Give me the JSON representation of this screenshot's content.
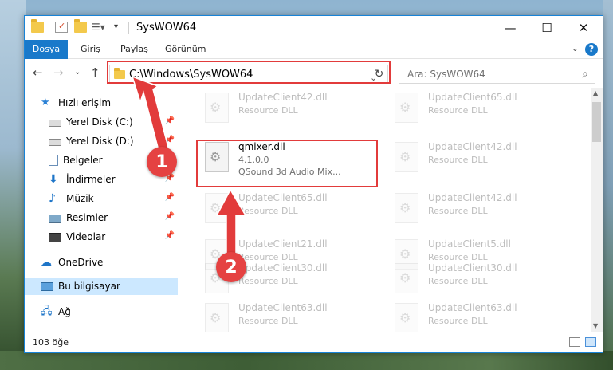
{
  "window": {
    "title": "SysWOW64",
    "minimize": "—",
    "maximize": "☐",
    "close": "✕"
  },
  "ribbon": {
    "tabs": [
      "Dosya",
      "Giriş",
      "Paylaş",
      "Görünüm"
    ],
    "help": "?"
  },
  "nav": {
    "address": "C:\\Windows\\SysWOW64",
    "search_placeholder": "Ara: SysWOW64"
  },
  "sidebar": {
    "items": [
      {
        "label": "Hızlı erişim",
        "icon": "star-icon"
      },
      {
        "label": "Yerel Disk (C:)",
        "icon": "drive-icon"
      },
      {
        "label": "Yerel Disk (D:)",
        "icon": "drive-icon"
      },
      {
        "label": "Belgeler",
        "icon": "documents-icon"
      },
      {
        "label": "İndirmeler",
        "icon": "download-icon"
      },
      {
        "label": "Müzik",
        "icon": "music-icon"
      },
      {
        "label": "Resimler",
        "icon": "pictures-icon"
      },
      {
        "label": "Videolar",
        "icon": "video-icon"
      },
      {
        "label": "OneDrive",
        "icon": "cloud-icon"
      },
      {
        "label": "Bu bilgisayar",
        "icon": "computer-icon"
      },
      {
        "label": "Ağ",
        "icon": "network-icon"
      }
    ]
  },
  "files": [
    {
      "name": "UpdateClient42.dll",
      "type": "Resource DLL"
    },
    {
      "name": "UpdateClient65.dll",
      "type": "Resource DLL"
    },
    {
      "name": "qmixer.dll",
      "type": "4.1.0.0",
      "desc": "QSound 3d Audio Mix..."
    },
    {
      "name": "UpdateClient42.dll",
      "type": "Resource DLL"
    },
    {
      "name": "UpdateClient65.dll",
      "type": "Resource DLL"
    },
    {
      "name": "UpdateClient42.dll",
      "type": "Resource DLL"
    },
    {
      "name": "UpdateClient21.dll",
      "type": "Resource DLL"
    },
    {
      "name": "UpdateClient5.dll",
      "type": "Resource DLL"
    },
    {
      "name": "UpdateClient30.dll",
      "type": "Resource DLL"
    },
    {
      "name": "UpdateClient30.dll",
      "type": "Resource DLL"
    },
    {
      "name": "UpdateClient63.dll",
      "type": "Resource DLL"
    },
    {
      "name": "UpdateClient63.dll",
      "type": "Resource DLL"
    }
  ],
  "status": {
    "count": "103 öğe"
  },
  "annotations": {
    "step1": "1",
    "step2": "2",
    "color": "#e23b3b"
  }
}
